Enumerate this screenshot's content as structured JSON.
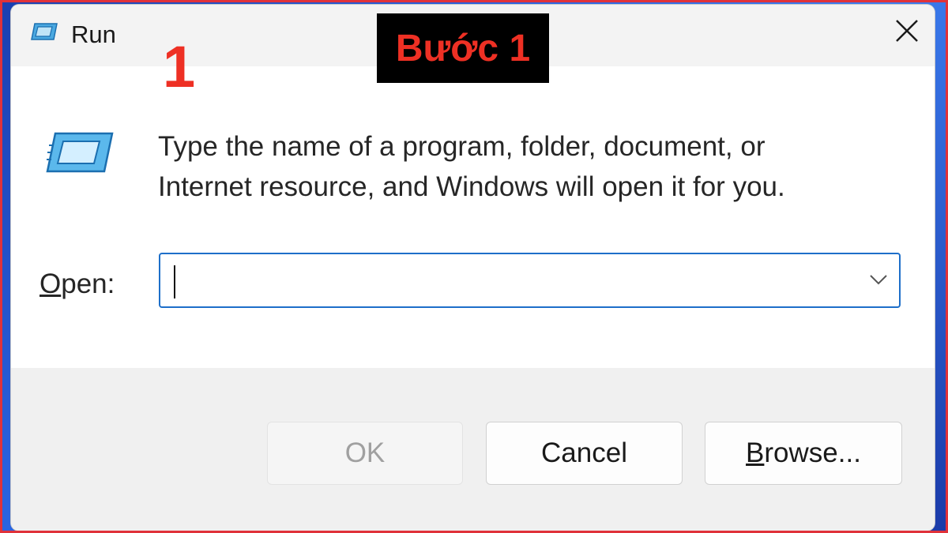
{
  "window": {
    "title": "Run",
    "close_label": "Close"
  },
  "annotations": {
    "step_badge": "Bước 1",
    "step_number": "1"
  },
  "description": {
    "line1": "Type the name of a program, folder, document, or",
    "line2": "Internet resource, and Windows will open it for you."
  },
  "open_field": {
    "label_accel": "O",
    "label_rest": "pen:",
    "value": "",
    "placeholder": ""
  },
  "buttons": {
    "ok": "OK",
    "cancel": "Cancel",
    "browse_accel": "B",
    "browse_rest": "rowse..."
  },
  "colors": {
    "accent": "#1e6fc9",
    "annotation_red": "#ee3024",
    "annotation_bg": "#000000",
    "frame_red": "#e0323a"
  },
  "icons": {
    "title": "run-app-icon",
    "body": "run-app-icon-large",
    "close": "close-icon",
    "dropdown": "chevron-down-icon"
  }
}
